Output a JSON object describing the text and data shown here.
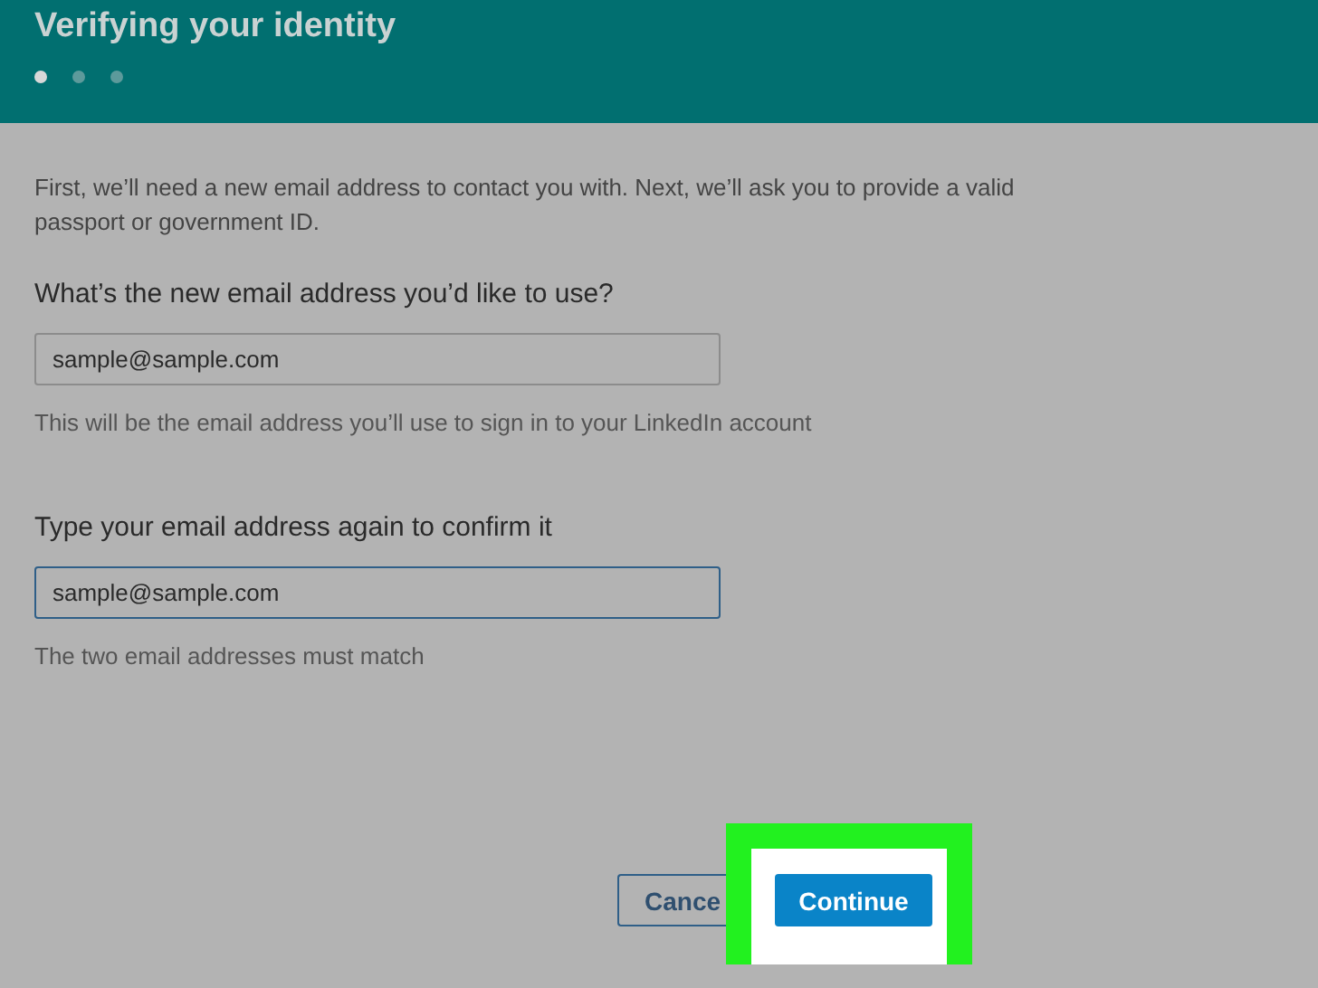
{
  "header": {
    "title": "Verifying your identity",
    "steps": [
      {
        "selected": true
      },
      {
        "selected": false
      },
      {
        "selected": false
      }
    ]
  },
  "intro": "First, we’ll need a new email address to contact you with. Next, we’ll ask you to provide a valid passport or government ID.",
  "fields": [
    {
      "label": "What’s the new email address you’d like to use?",
      "value": "sample@sample.com",
      "focused": false,
      "hint": "This will be the email address you’ll use to sign in to your LinkedIn account"
    },
    {
      "label": "Type your email address again to confirm it",
      "value": "sample@sample.com",
      "focused": true,
      "hint": "The two email addresses must match"
    }
  ],
  "buttons": {
    "cancel": "Cance",
    "continue": "Continue"
  }
}
